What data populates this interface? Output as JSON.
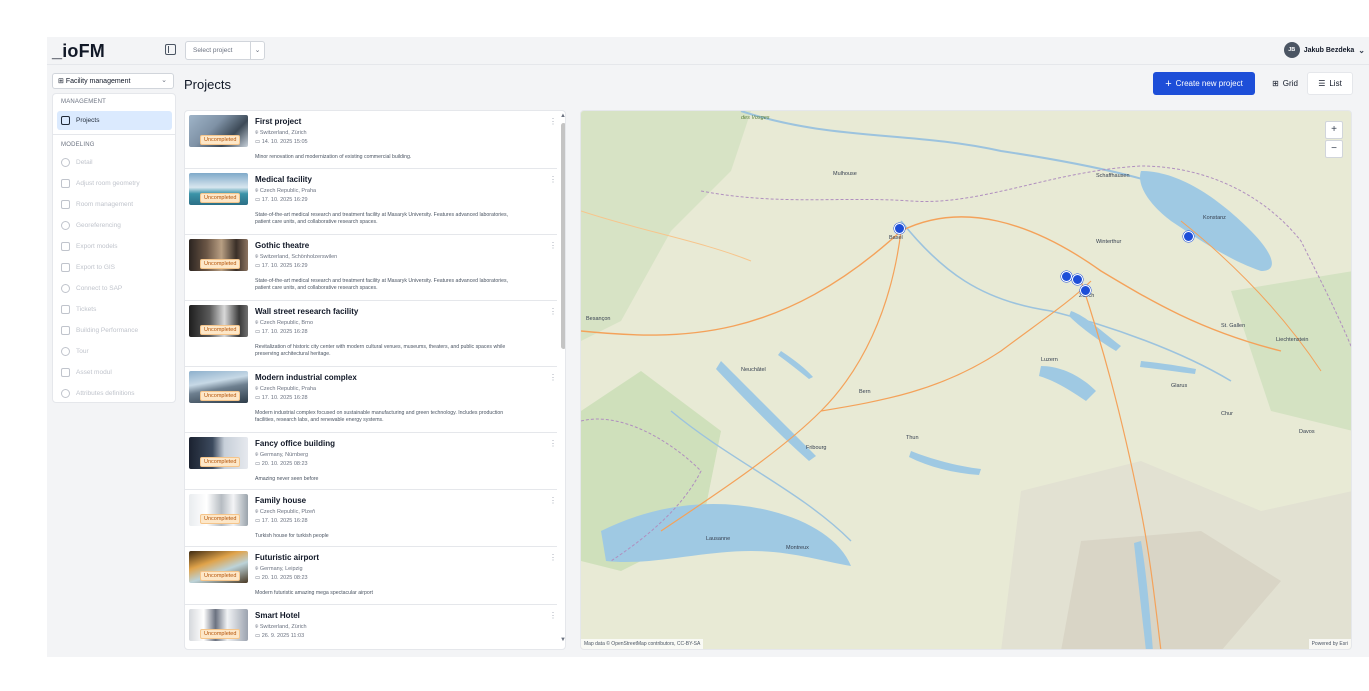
{
  "app": {
    "logo": "_ioFM"
  },
  "header": {
    "project_select_placeholder": "Select project",
    "user_initials": "JB",
    "user_name": "Jakub Bezdeka"
  },
  "sidebar": {
    "facility_label": "Facility management",
    "management_section": "MANAGEMENT",
    "management_items": [
      {
        "label": "Projects",
        "icon": "folder-icon",
        "active": true
      }
    ],
    "modeling_section": "MODELING",
    "modeling_items": [
      {
        "label": "Detail",
        "icon": "info-icon"
      },
      {
        "label": "Adjust room geometry",
        "icon": "cube-icon"
      },
      {
        "label": "Room management",
        "icon": "cube-icon"
      },
      {
        "label": "Georeferencing",
        "icon": "pin-icon"
      },
      {
        "label": "Export models",
        "icon": "upload-icon"
      },
      {
        "label": "Export to GIS",
        "icon": "upload-icon"
      },
      {
        "label": "Connect to SAP",
        "icon": "plug-icon"
      },
      {
        "label": "Tickets",
        "icon": "ticket-icon"
      },
      {
        "label": "Building Performance",
        "icon": "network-icon"
      },
      {
        "label": "Tour",
        "icon": "walk-icon"
      },
      {
        "label": "Asset modul",
        "icon": "grid-icon"
      },
      {
        "label": "Attributes definitions",
        "icon": "gear-icon"
      }
    ]
  },
  "main": {
    "title": "Projects",
    "create_button": "Create new project",
    "view_grid": "Grid",
    "view_list": "List"
  },
  "status_label": "Uncompleted",
  "projects": [
    {
      "name": "First project",
      "location": "Switzerland, Zürich",
      "date": "14. 10. 2025 15:05",
      "description": "Minor renovation and modernization of existing commercial building."
    },
    {
      "name": "Medical facility",
      "location": "Czech Republic, Praha",
      "date": "17. 10. 2025 16:29",
      "description": "State-of-the-art medical research and treatment facility at Masaryk University. Features advanced laboratories, patient care units, and collaborative research spaces."
    },
    {
      "name": "Gothic theatre",
      "location": "Switzerland, Schönholzerswilen",
      "date": "17. 10. 2025 16:29",
      "description": "State-of-the-art medical research and treatment facility at Masaryk University. Features advanced laboratories, patient care units, and collaborative research spaces."
    },
    {
      "name": "Wall street research facility",
      "location": "Czech Republic, Brno",
      "date": "17. 10. 2025 16:28",
      "description": "Revitalization of historic city center with modern cultural venues, museums, theaters, and public spaces while preserving architectural heritage."
    },
    {
      "name": "Modern industrial complex",
      "location": "Czech Republic, Praha",
      "date": "17. 10. 2025 16:28",
      "description": "Modern industrial complex focused on sustainable manufacturing and green technology. Includes production facilities, research labs, and renewable energy systems."
    },
    {
      "name": "Fancy office building",
      "location": "Germany, Nürnberg",
      "date": "20. 10. 2025 08:23",
      "description": "Amazing never seen before"
    },
    {
      "name": "Family house",
      "location": "Czech Republic, Plzeň",
      "date": "17. 10. 2025 16:28",
      "description": "Turkish house for turkish people"
    },
    {
      "name": "Futuristic airport",
      "location": "Germany, Leipzig",
      "date": "20. 10. 2025 08:23",
      "description": "Modern futuristic amazing mega spectacular airport"
    },
    {
      "name": "Smart Hotel",
      "location": "Switzerland, Zürich",
      "date": "26. 9. 2025 11:03",
      "description": ""
    }
  ],
  "map": {
    "attribution": "Map data © OpenStreetMap contributors, CC-BY-SA",
    "powered_by": "Powered by Esri",
    "zoom_in": "+",
    "zoom_out": "−",
    "labels": [
      "des Vosges",
      "Besançon",
      "Basel",
      "Winterthur",
      "Zürich",
      "Konstanz",
      "Bern",
      "Luzern",
      "Lausanne",
      "Liechtenstein",
      "St. Gallen",
      "Fribourg",
      "Neuchâtel",
      "Montreux",
      "Thun",
      "Glarus",
      "Chur",
      "Davos",
      "Mulhouse",
      "Schaffhausen"
    ]
  }
}
